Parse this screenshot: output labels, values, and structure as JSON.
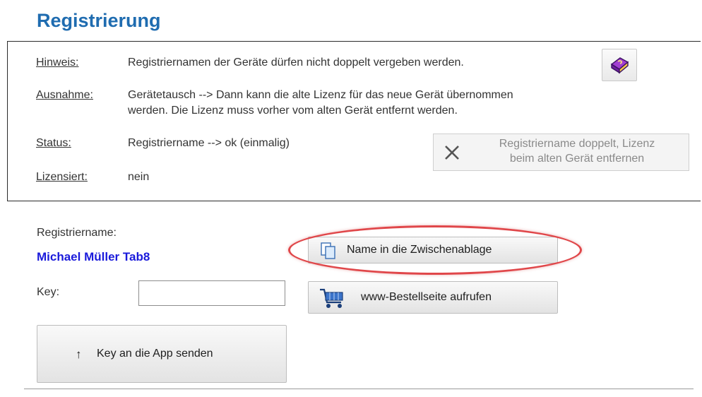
{
  "title": "Registrierung",
  "info": {
    "hinweis_label": "Hinweis:",
    "hinweis_text": "Registriernamen der Geräte dürfen nicht doppelt vergeben werden.",
    "ausnahme_label": "Ausnahme:",
    "ausnahme_line1": "Gerätetausch  --> Dann kann die alte Lizenz für das neue Gerät übernommen",
    "ausnahme_line2": "werden. Die Lizenz muss vorher vom alten Gerät entfernt werden.",
    "status_label": "Status:",
    "status_text": "Registriername  --> ok (einmalig)",
    "lizensiert_label": "Lizensiert:",
    "lizensiert_value": "nein",
    "error_button_line1": "Registriername doppelt, Lizenz",
    "error_button_line2": "beim alten Gerät entfernen"
  },
  "registration": {
    "name_label": "Registriername:",
    "name_value": "Michael Müller Tab8",
    "key_label": "Key:",
    "key_value": "",
    "copy_button": "Name in die Zwischenablage",
    "order_button": "www-Bestellseite aufrufen",
    "send_button": "Key an die App senden",
    "send_arrow": "↑"
  },
  "colors": {
    "title": "#1f6cb0",
    "name_value": "#1a1adb",
    "highlight_oval": "#e0474a"
  },
  "icons": {
    "help": "help-book-icon",
    "error": "close-x-icon",
    "copy": "copy-documents-icon",
    "order": "shopping-cart-icon",
    "send": "arrow-up-icon"
  }
}
